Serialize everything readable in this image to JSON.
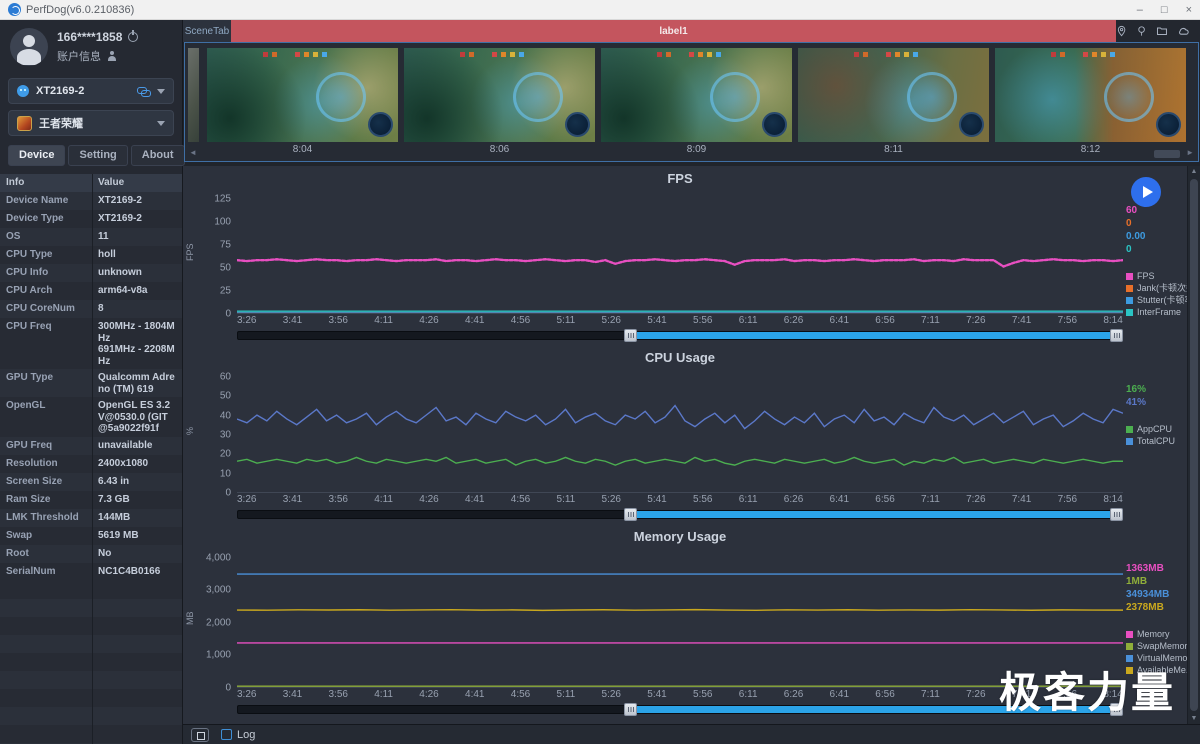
{
  "window": {
    "title": "PerfDog(v6.0.210836)",
    "controls": [
      "minimize",
      "maximize",
      "close"
    ]
  },
  "sidebar": {
    "user": {
      "name": "166****1858",
      "account_label": "账户信息"
    },
    "device_select": {
      "value": "XT2169-2"
    },
    "app_select": {
      "value": "王者荣耀"
    },
    "tabs": [
      {
        "label": "Device",
        "active": true
      },
      {
        "label": "Setting",
        "active": false
      },
      {
        "label": "About",
        "active": false
      }
    ],
    "table": {
      "headers": [
        "Info",
        "Value"
      ],
      "rows": [
        {
          "label": "Device Name",
          "value": "XT2169-2"
        },
        {
          "label": "Device Type",
          "value": "XT2169-2"
        },
        {
          "label": "OS",
          "value": "11"
        },
        {
          "label": "CPU Type",
          "value": "holl"
        },
        {
          "label": "CPU Info",
          "value": "unknown"
        },
        {
          "label": "CPU Arch",
          "value": "arm64-v8a"
        },
        {
          "label": "CPU CoreNum",
          "value": "8"
        },
        {
          "label": "CPU Freq",
          "value": "300MHz - 1804MHz\n691MHz - 2208MHz"
        },
        {
          "label": "GPU Type",
          "value": "Qualcomm Adreno (TM) 619"
        },
        {
          "label": "OpenGL",
          "value": "OpenGL ES 3.2 V@0530.0 (GIT@5a9022f91f"
        },
        {
          "label": "GPU Freq",
          "value": "unavailable"
        },
        {
          "label": "Resolution",
          "value": "2400x1080"
        },
        {
          "label": "Screen Size",
          "value": "6.43 in"
        },
        {
          "label": "Ram Size",
          "value": "7.3 GB"
        },
        {
          "label": "LMK Threshold",
          "value": "144MB"
        },
        {
          "label": "Swap",
          "value": "5619 MB"
        },
        {
          "label": "Root",
          "value": "No"
        },
        {
          "label": "SerialNum",
          "value": "NC1C4B0166"
        }
      ]
    }
  },
  "scene": {
    "tab_label": "SceneTab",
    "label": "label1",
    "bar_color": "#c4555e",
    "thumbnails": [
      {
        "time": "8:04"
      },
      {
        "time": "8:06"
      },
      {
        "time": "8:09"
      },
      {
        "time": "8:11"
      },
      {
        "time": "8:12"
      }
    ]
  },
  "top_icons": [
    "location-pin",
    "balloon-pin",
    "folder",
    "cloud"
  ],
  "bottom": {
    "log_label": "Log"
  },
  "watermark": "极客力量",
  "chart_data": [
    {
      "type": "line",
      "title": "FPS",
      "ylabel": "FPS",
      "ylim": [
        0,
        135
      ],
      "yticks": [
        {
          "v": 0,
          "label": "0"
        },
        {
          "v": 25,
          "label": "25"
        },
        {
          "v": 50,
          "label": "50"
        },
        {
          "v": 75,
          "label": "75"
        },
        {
          "v": 100,
          "label": "100"
        },
        {
          "v": 125,
          "label": "125"
        }
      ],
      "x_ticks": [
        "3:26",
        "3:41",
        "3:56",
        "4:11",
        "4:26",
        "4:41",
        "4:56",
        "5:11",
        "5:26",
        "5:41",
        "5:56",
        "6:11",
        "6:26",
        "6:41",
        "6:56",
        "7:11",
        "7:26",
        "7:41",
        "7:56",
        "8:14"
      ],
      "grid": false,
      "legend_position": "right",
      "series": [
        {
          "name": "Jank(卡顿次数)",
          "color": "#e8702a",
          "style": "solid",
          "values": [
            0,
            0
          ]
        },
        {
          "name": "Stutter(卡顿率)",
          "color": "#3d9be0",
          "style": "solid",
          "values": [
            0,
            0
          ]
        },
        {
          "name": "InterFrame",
          "color": "#2bc4c4",
          "style": "solid",
          "values": [
            2,
            2
          ]
        },
        {
          "name": "FPS",
          "color": "#e84fc1",
          "style": "dots",
          "values": [
            58,
            57,
            58,
            58,
            59,
            58,
            57,
            58,
            59,
            58,
            58,
            57,
            58,
            58,
            59,
            58,
            57,
            58,
            58,
            58,
            59,
            57,
            58,
            58,
            57,
            58,
            59,
            58,
            58,
            57,
            58,
            59,
            58,
            57,
            58,
            58,
            56,
            58,
            54,
            57,
            58,
            58,
            59,
            58,
            57,
            58,
            58,
            59,
            58,
            57,
            53,
            57,
            58,
            58,
            58,
            59,
            57,
            58,
            58,
            57,
            58,
            58,
            59,
            58,
            57,
            58,
            58,
            58,
            59,
            57,
            58,
            58,
            57,
            59,
            58,
            58,
            58,
            51,
            55,
            58,
            57,
            58,
            59,
            58,
            58,
            57,
            58,
            58,
            57,
            58
          ]
        }
      ],
      "current_values": [
        {
          "text": "60",
          "color": "#e84fc1"
        },
        {
          "text": "0",
          "color": "#e8702a"
        },
        {
          "text": "0.00",
          "color": "#3d9be0"
        },
        {
          "text": "0",
          "color": "#2bc4c4"
        }
      ],
      "legend": [
        {
          "label": "FPS",
          "color": "#e84fc1"
        },
        {
          "label": "Jank(卡顿次数)",
          "color": "#e8702a"
        },
        {
          "label": "Stutter(卡顿率)",
          "color": "#3d9be0"
        },
        {
          "label": "InterFrame",
          "color": "#2bc4c4"
        }
      ]
    },
    {
      "type": "line",
      "title": "CPU Usage",
      "ylabel": "%",
      "ylim": [
        0,
        64
      ],
      "yticks": [
        {
          "v": 0,
          "label": "0"
        },
        {
          "v": 10,
          "label": "10"
        },
        {
          "v": 20,
          "label": "20"
        },
        {
          "v": 30,
          "label": "30"
        },
        {
          "v": 40,
          "label": "40"
        },
        {
          "v": 50,
          "label": "50"
        },
        {
          "v": 60,
          "label": "60"
        }
      ],
      "x_ticks": [
        "3:26",
        "3:41",
        "3:56",
        "4:11",
        "4:26",
        "4:41",
        "4:56",
        "5:11",
        "5:26",
        "5:41",
        "5:56",
        "6:11",
        "6:26",
        "6:41",
        "6:56",
        "7:11",
        "7:26",
        "7:41",
        "7:56",
        "8:14"
      ],
      "grid": false,
      "legend_position": "right",
      "series": [
        {
          "name": "TotalCPU",
          "color": "#5b78c9",
          "style": "solid",
          "values": [
            38,
            36,
            40,
            37,
            42,
            38,
            35,
            39,
            43,
            37,
            40,
            36,
            38,
            41,
            35,
            39,
            42,
            38,
            36,
            40,
            44,
            37,
            39,
            35,
            41,
            38,
            36,
            42,
            39,
            37,
            40,
            35,
            38,
            43,
            36,
            39,
            41,
            37,
            35,
            40,
            38,
            42,
            36,
            39,
            45,
            37,
            34,
            38,
            41,
            36,
            40,
            33,
            37,
            42,
            38,
            35,
            39,
            36,
            41,
            34,
            38,
            40,
            36,
            43,
            37,
            39,
            35,
            41,
            38,
            36,
            44,
            39,
            37,
            40,
            35,
            38,
            41,
            36,
            39,
            42,
            35,
            38,
            40,
            34,
            37,
            41,
            38,
            36,
            43,
            41
          ]
        },
        {
          "name": "AppCPU",
          "color": "#4caf50",
          "style": "solid",
          "values": [
            16,
            17,
            15,
            16,
            17,
            16,
            15,
            17,
            16,
            17,
            15,
            16,
            18,
            16,
            15,
            17,
            16,
            15,
            16,
            17,
            16,
            18,
            15,
            16,
            17,
            15,
            16,
            17,
            14,
            16,
            17,
            15,
            16,
            18,
            16,
            15,
            17,
            16,
            14,
            16,
            17,
            15,
            16,
            17,
            16,
            15,
            18,
            16,
            17,
            15,
            14,
            16,
            17,
            16,
            15,
            17,
            16,
            15,
            16,
            17,
            15,
            16,
            18,
            16,
            15,
            16,
            17,
            14,
            16,
            15,
            17,
            16,
            18,
            15,
            16,
            17,
            15,
            16,
            17,
            16,
            15,
            17,
            16,
            15,
            16,
            17,
            16,
            15,
            16,
            16
          ]
        }
      ],
      "current_values": [
        {
          "text": "16%",
          "color": "#4caf50"
        },
        {
          "text": "41%",
          "color": "#5b78c9"
        }
      ],
      "legend": [
        {
          "label": "AppCPU",
          "color": "#4caf50"
        },
        {
          "label": "TotalCPU",
          "color": "#4a90d9"
        }
      ]
    },
    {
      "type": "line",
      "title": "Memory Usage",
      "ylabel": "MB",
      "ylim": [
        0,
        4300
      ],
      "yticks": [
        {
          "v": 0,
          "label": "0"
        },
        {
          "v": 1000,
          "label": "1,000"
        },
        {
          "v": 2000,
          "label": "2,000"
        },
        {
          "v": 3000,
          "label": "3,000"
        },
        {
          "v": 4000,
          "label": "4,000"
        }
      ],
      "x_ticks": [
        "3:26",
        "3:41",
        "3:56",
        "4:11",
        "4:26",
        "4:41",
        "4:56",
        "5:11",
        "5:26",
        "5:41",
        "5:56",
        "6:11",
        "6:26",
        "6:41",
        "6:56",
        "7:11",
        "7:26",
        "7:41",
        "7:56",
        "8:14"
      ],
      "grid": false,
      "legend_position": "right",
      "series": [
        {
          "name": "VirtualMemory",
          "color": "#4a90d9",
          "style": "solid",
          "values": [
            3493,
            3493,
            3493,
            3493,
            3493,
            3493,
            3493,
            3493,
            3493,
            3493
          ]
        },
        {
          "name": "AvailableMemory",
          "color": "#c9a81e",
          "style": "solid",
          "values": [
            2380,
            2376,
            2388,
            2382,
            2390,
            2375,
            2384,
            2392,
            2378,
            2386,
            2370,
            2382,
            2390,
            2377,
            2385,
            2394,
            2380,
            2372,
            2388,
            2381,
            2390,
            2376,
            2384,
            2378,
            2392,
            2383,
            2374,
            2386,
            2380,
            2378
          ]
        },
        {
          "name": "Memory",
          "color": "#e84fc1",
          "style": "solid",
          "values": [
            1363,
            1362,
            1364,
            1363,
            1362,
            1364,
            1363,
            1363,
            1362,
            1363
          ]
        },
        {
          "name": "SwapMemory",
          "color": "#8fae3a",
          "style": "solid",
          "values": [
            25,
            25,
            25,
            25,
            25,
            25,
            25,
            25,
            25,
            25
          ]
        }
      ],
      "current_values": [
        {
          "text": "1363MB",
          "color": "#e84fc1"
        },
        {
          "text": "1MB",
          "color": "#8fae3a"
        },
        {
          "text": "34934MB",
          "color": "#4a90d9"
        },
        {
          "text": "2378MB",
          "color": "#c9a81e"
        }
      ],
      "legend": [
        {
          "label": "Memory",
          "color": "#e84fc1"
        },
        {
          "label": "SwapMemory",
          "color": "#8fae3a"
        },
        {
          "label": "VirtualMemory",
          "color": "#4a90d9"
        },
        {
          "label": "AvailableMe...",
          "color": "#c9a81e"
        }
      ]
    }
  ]
}
